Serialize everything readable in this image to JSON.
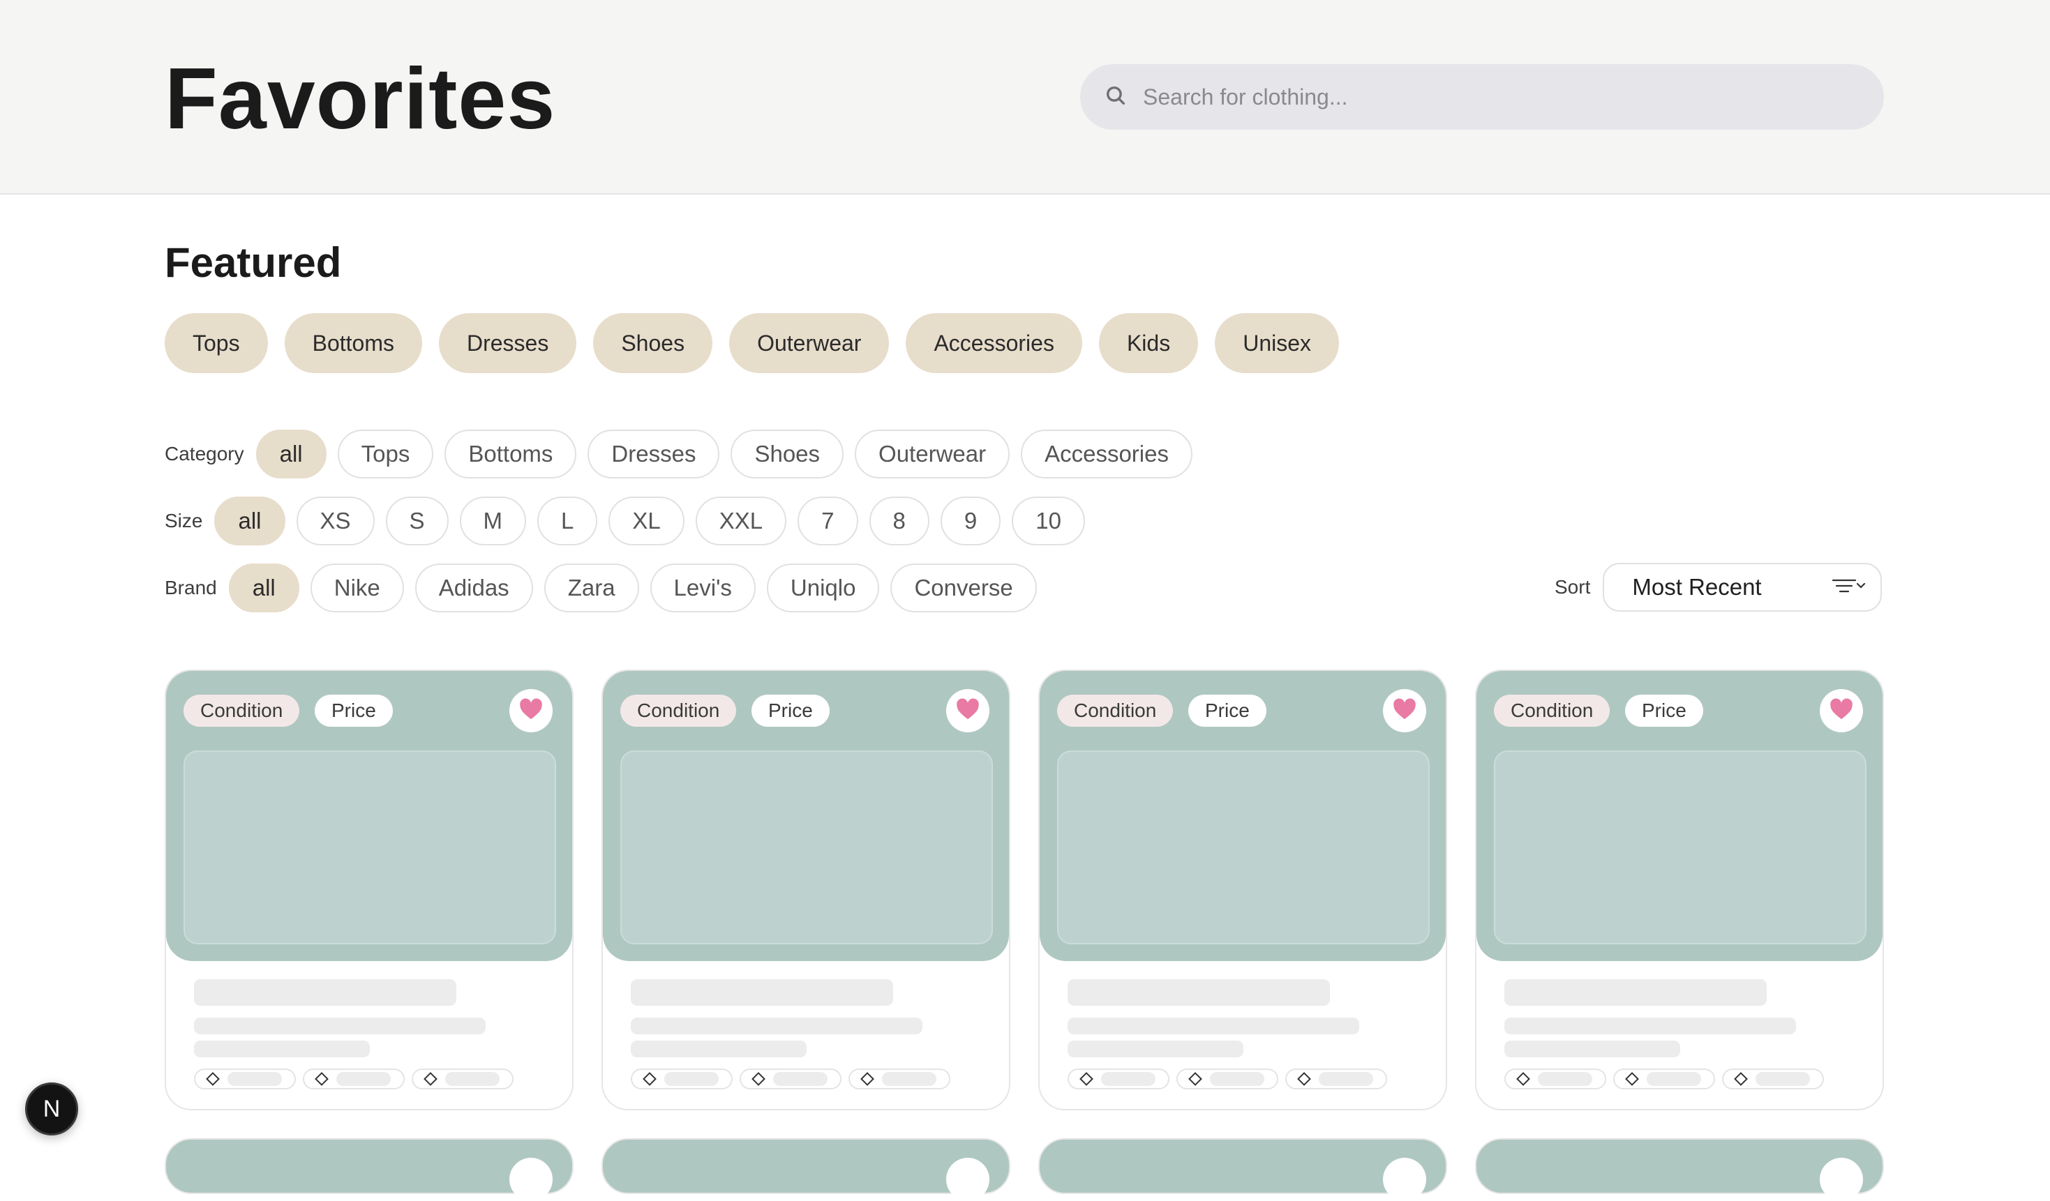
{
  "header": {
    "title": "Favorites",
    "search_placeholder": "Search for clothing..."
  },
  "featured": {
    "title": "Featured",
    "items": [
      "Tops",
      "Bottoms",
      "Dresses",
      "Shoes",
      "Outerwear",
      "Accessories",
      "Kids",
      "Unisex"
    ]
  },
  "filters": {
    "category": {
      "label": "Category",
      "options": [
        "all",
        "Tops",
        "Bottoms",
        "Dresses",
        "Shoes",
        "Outerwear",
        "Accessories"
      ],
      "selected": "all"
    },
    "size": {
      "label": "Size",
      "options": [
        "all",
        "XS",
        "S",
        "M",
        "L",
        "XL",
        "XXL",
        "7",
        "8",
        "9",
        "10"
      ],
      "selected": "all"
    },
    "brand": {
      "label": "Brand",
      "options": [
        "all",
        "Nike",
        "Adidas",
        "Zara",
        "Levi's",
        "Uniqlo",
        "Converse"
      ],
      "selected": "all"
    }
  },
  "sort": {
    "label": "Sort",
    "value": "Most Recent",
    "icon": "sort-filter-icon"
  },
  "cards": [
    {
      "condition_label": "Condition",
      "price_label": "Price",
      "favorited": true
    },
    {
      "condition_label": "Condition",
      "price_label": "Price",
      "favorited": true
    },
    {
      "condition_label": "Condition",
      "price_label": "Price",
      "favorited": true
    },
    {
      "condition_label": "Condition",
      "price_label": "Price",
      "favorited": true
    }
  ],
  "badge": {
    "letter": "N",
    "icon": "nextjs-badge-icon"
  },
  "colors": {
    "header_bg": "#f5f5f4",
    "search_bg": "#e6e6ea",
    "pill_beige": "#e7ddcb",
    "card_media": "#afc7c1",
    "condition_tag": "#f3e8e8",
    "heart": "#e87aa3"
  }
}
